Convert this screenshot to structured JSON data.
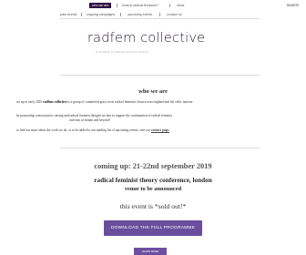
{
  "nav": {
    "row1": [
      "who we are",
      "what is radical feminism?",
      "news"
    ],
    "row2": [
      "past events",
      "ongoing campaigns",
      "upcoming events",
      "contact us"
    ],
    "search_label": "search"
  },
  "header": {
    "site_title": "radfem collective",
    "tagline": "A network of radical feminist women"
  },
  "about": {
    "title": "who we are",
    "p1_before": "set up in early 2016 ",
    "p1_bold": "radfem collective",
    "p1_after": " is a group of committed grass roots radical feminists from across england and the celtic nations.",
    "p2_line1": "by promoting consciousness raising and radical feminist thought we aim to support the continuation of radical feminist",
    "p2_line2": "activism in britain and beyond!",
    "p3_before": "to find out more about the work we do, or to be added to our mailing list of upcoming events, visit our ",
    "p3_link": "contact page."
  },
  "event": {
    "coming_up": "coming up: 21-22nd september 2019",
    "title": "radical feminist theory conference, london",
    "venue": "venue to be announced",
    "sold_out": "this event is *sold out!*"
  },
  "buttons": {
    "programme": "DOWNLOAD THE FULL PROGRAMME",
    "learn_more": "LEARN MORE"
  },
  "colors": {
    "nav_active_bg": "#2f1145",
    "button_bg": "#6a4e9d",
    "title_color": "#2b1a37"
  }
}
